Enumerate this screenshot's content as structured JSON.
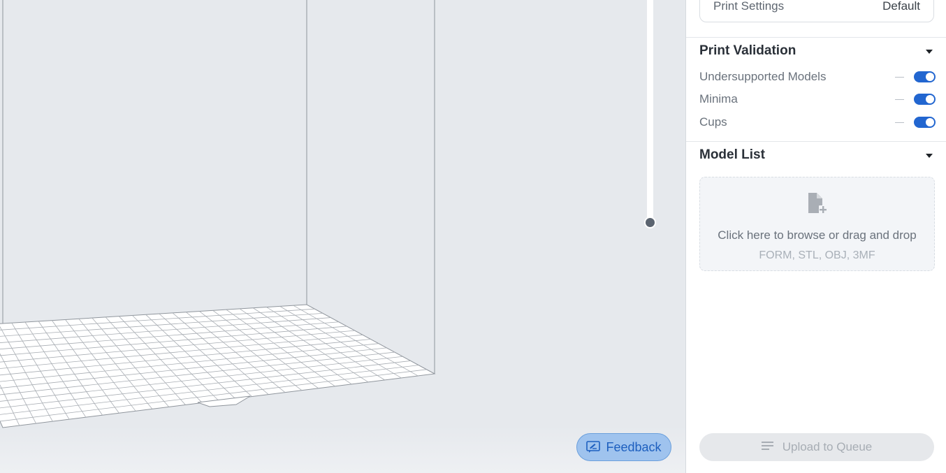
{
  "viewport": {
    "feedback_label": "Feedback",
    "icons": {
      "feedback": "feedback-icon"
    }
  },
  "panel": {
    "print_settings": {
      "label": "Print Settings",
      "value": "Default"
    },
    "print_validation": {
      "title": "Print Validation",
      "items": [
        {
          "label": "Undersupported Models",
          "enabled": true
        },
        {
          "label": "Minima",
          "enabled": true
        },
        {
          "label": "Cups",
          "enabled": true
        }
      ]
    },
    "model_list": {
      "title": "Model List",
      "dropzone_text": "Click here to browse or drag and drop",
      "dropzone_formats": "FORM, STL, OBJ, 3MF",
      "icon": "add-file-icon"
    },
    "upload_label": "Upload to Queue",
    "colors": {
      "accent": "#2266d0",
      "feedback_bg": "#9fc3ee"
    }
  }
}
